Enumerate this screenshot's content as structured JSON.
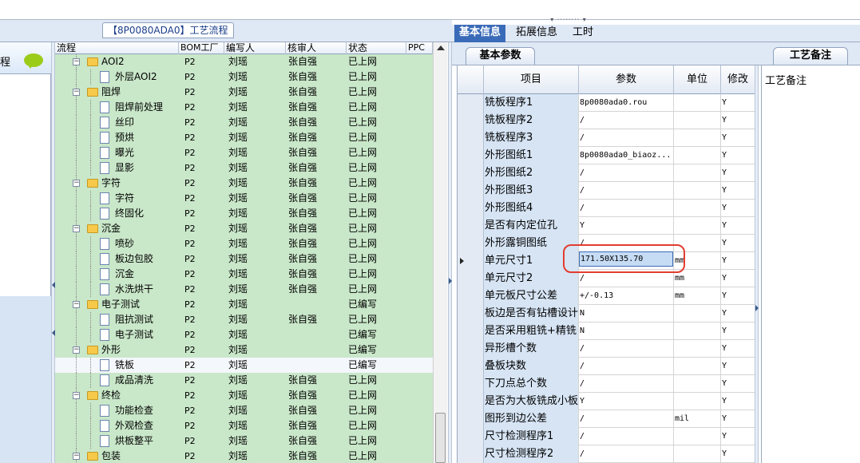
{
  "title_tab": "【8P0080ADA0】工艺流程",
  "left_panel": {
    "label": "程"
  },
  "grid": {
    "columns": [
      "流程",
      "BOM工厂",
      "编写人",
      "核审人",
      "状态",
      "PPC"
    ],
    "rows": [
      {
        "level": 0,
        "type": "folder",
        "name": "AOI2",
        "bom": "P2",
        "writer": "刘瑶",
        "reviewer": "张自强",
        "status": "已上网"
      },
      {
        "level": 1,
        "type": "doc",
        "name": "外层AOI2",
        "bom": "P2",
        "writer": "刘瑶",
        "reviewer": "张自强",
        "status": "已上网"
      },
      {
        "level": 0,
        "type": "folder",
        "name": "阻焊",
        "bom": "P2",
        "writer": "刘瑶",
        "reviewer": "张自强",
        "status": "已上网"
      },
      {
        "level": 1,
        "type": "doc",
        "name": "阻焊前处理",
        "bom": "P2",
        "writer": "刘瑶",
        "reviewer": "张自强",
        "status": "已上网"
      },
      {
        "level": 1,
        "type": "doc",
        "name": "丝印",
        "bom": "P2",
        "writer": "刘瑶",
        "reviewer": "张自强",
        "status": "已上网"
      },
      {
        "level": 1,
        "type": "doc",
        "name": "预烘",
        "bom": "P2",
        "writer": "刘瑶",
        "reviewer": "张自强",
        "status": "已上网"
      },
      {
        "level": 1,
        "type": "doc",
        "name": "曝光",
        "bom": "P2",
        "writer": "刘瑶",
        "reviewer": "张自强",
        "status": "已上网"
      },
      {
        "level": 1,
        "type": "doc",
        "name": "显影",
        "bom": "P2",
        "writer": "刘瑶",
        "reviewer": "张自强",
        "status": "已上网"
      },
      {
        "level": 0,
        "type": "folder",
        "name": "字符",
        "bom": "P2",
        "writer": "刘瑶",
        "reviewer": "张自强",
        "status": "已上网"
      },
      {
        "level": 1,
        "type": "doc",
        "name": "字符",
        "bom": "P2",
        "writer": "刘瑶",
        "reviewer": "张自强",
        "status": "已上网"
      },
      {
        "level": 1,
        "type": "doc",
        "name": "终固化",
        "bom": "P2",
        "writer": "刘瑶",
        "reviewer": "张自强",
        "status": "已上网"
      },
      {
        "level": 0,
        "type": "folder",
        "name": "沉金",
        "bom": "P2",
        "writer": "刘瑶",
        "reviewer": "张自强",
        "status": "已上网"
      },
      {
        "level": 1,
        "type": "doc",
        "name": "喷砂",
        "bom": "P2",
        "writer": "刘瑶",
        "reviewer": "张自强",
        "status": "已上网"
      },
      {
        "level": 1,
        "type": "doc",
        "name": "板边包胶",
        "bom": "P2",
        "writer": "刘瑶",
        "reviewer": "张自强",
        "status": "已上网"
      },
      {
        "level": 1,
        "type": "doc",
        "name": "沉金",
        "bom": "P2",
        "writer": "刘瑶",
        "reviewer": "张自强",
        "status": "已上网"
      },
      {
        "level": 1,
        "type": "doc",
        "name": "水洗烘干",
        "bom": "P2",
        "writer": "刘瑶",
        "reviewer": "张自强",
        "status": "已上网"
      },
      {
        "level": 0,
        "type": "folder",
        "name": "电子测试",
        "bom": "P2",
        "writer": "刘瑶",
        "reviewer": "",
        "status": "已编写"
      },
      {
        "level": 1,
        "type": "doc",
        "name": "阻抗测试",
        "bom": "P2",
        "writer": "刘瑶",
        "reviewer": "张自强",
        "status": "已上网"
      },
      {
        "level": 1,
        "type": "doc",
        "name": "电子测试",
        "bom": "P2",
        "writer": "刘瑶",
        "reviewer": "",
        "status": "已编写"
      },
      {
        "level": 0,
        "type": "folder",
        "name": "外形",
        "bom": "P2",
        "writer": "刘瑶",
        "reviewer": "",
        "status": "已编写"
      },
      {
        "level": 1,
        "type": "doc",
        "name": "铣板",
        "bom": "P2",
        "writer": "刘瑶",
        "reviewer": "",
        "status": "已编写",
        "selected": true
      },
      {
        "level": 1,
        "type": "doc",
        "name": "成品清洗",
        "bom": "P2",
        "writer": "刘瑶",
        "reviewer": "张自强",
        "status": "已上网"
      },
      {
        "level": 0,
        "type": "folder",
        "name": "终检",
        "bom": "P2",
        "writer": "刘瑶",
        "reviewer": "张自强",
        "status": "已上网"
      },
      {
        "level": 1,
        "type": "doc",
        "name": "功能检查",
        "bom": "P2",
        "writer": "刘瑶",
        "reviewer": "张自强",
        "status": "已上网"
      },
      {
        "level": 1,
        "type": "doc",
        "name": "外观检查",
        "bom": "P2",
        "writer": "刘瑶",
        "reviewer": "张自强",
        "status": "已上网"
      },
      {
        "level": 1,
        "type": "doc",
        "name": "烘板整平",
        "bom": "P2",
        "writer": "刘瑶",
        "reviewer": "张自强",
        "status": "已上网"
      },
      {
        "level": 0,
        "type": "folder",
        "name": "包装",
        "bom": "P2",
        "writer": "刘瑶",
        "reviewer": "张自强",
        "status": "已上网"
      }
    ]
  },
  "right_tabs": [
    "基本信息",
    "拓展信息",
    "工时"
  ],
  "basic_params_tab": "基本参数",
  "params": {
    "columns": [
      "项目",
      "参数",
      "单位",
      "修改"
    ],
    "rows": [
      {
        "name": "铣板程序1",
        "value": "8p0080ada0.rou",
        "unit": "",
        "mod": "Y"
      },
      {
        "name": "铣板程序2",
        "value": "/",
        "unit": "",
        "mod": "Y"
      },
      {
        "name": "铣板程序3",
        "value": "/",
        "unit": "",
        "mod": "Y"
      },
      {
        "name": "外形图纸1",
        "value": "8p0080ada0_biaoz...",
        "unit": "",
        "mod": "Y"
      },
      {
        "name": "外形图纸2",
        "value": "/",
        "unit": "",
        "mod": "Y"
      },
      {
        "name": "外形图纸3",
        "value": "/",
        "unit": "",
        "mod": "Y"
      },
      {
        "name": "外形图纸4",
        "value": "/",
        "unit": "",
        "mod": "Y"
      },
      {
        "name": "是否有内定位孔",
        "value": "Y",
        "unit": "",
        "mod": "Y"
      },
      {
        "name": "外形露铜图纸",
        "value": "/",
        "unit": "",
        "mod": "Y"
      },
      {
        "name": "单元尺寸1",
        "value": "171.50X135.70",
        "unit": "mm",
        "mod": "Y",
        "current": true
      },
      {
        "name": "单元尺寸2",
        "value": "/",
        "unit": "mm",
        "mod": "Y"
      },
      {
        "name": "单元板尺寸公差",
        "value": "+/-0.13",
        "unit": "mm",
        "mod": "Y"
      },
      {
        "name": "板边是否有钻槽设计",
        "value": "N",
        "unit": "",
        "mod": "Y"
      },
      {
        "name": "是否采用粗铣+精铣",
        "value": "N",
        "unit": "",
        "mod": "Y"
      },
      {
        "name": "异形槽个数",
        "value": "/",
        "unit": "",
        "mod": "Y"
      },
      {
        "name": "叠板块数",
        "value": "/",
        "unit": "",
        "mod": "Y"
      },
      {
        "name": "下刀点总个数",
        "value": "/",
        "unit": "",
        "mod": "Y"
      },
      {
        "name": "是否为大板铣成小板",
        "value": "Y",
        "unit": "",
        "mod": "Y"
      },
      {
        "name": "图形到边公差",
        "value": "/",
        "unit": "mil",
        "mod": "Y"
      },
      {
        "name": "尺寸检测程序1",
        "value": "/",
        "unit": "",
        "mod": "Y"
      },
      {
        "name": "尺寸检测程序2",
        "value": "/",
        "unit": "",
        "mod": "Y"
      }
    ]
  },
  "remarks_tab": "工艺备注",
  "remarks_label": "工艺备注",
  "colors": {
    "row_green": "#c9e7c9",
    "accent_blue": "#3a6bb8",
    "highlight_red": "#e23d2f"
  }
}
